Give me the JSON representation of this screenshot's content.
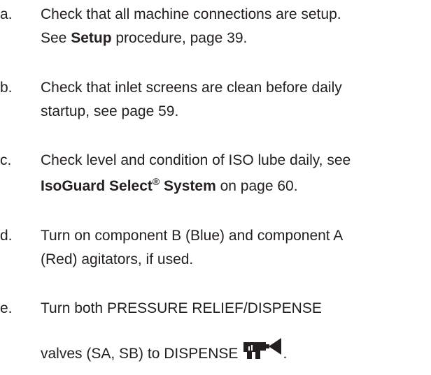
{
  "steps": [
    {
      "marker": "a.",
      "line1": "Check that all machine connections are setup.",
      "line2_prefix": "See ",
      "line2_bold": "Setup",
      "line2_suffix": " procedure, page 39."
    },
    {
      "marker": "b.",
      "line1": "Check that inlet screens are clean before daily",
      "line2": "startup, see page 59."
    },
    {
      "marker": "c.",
      "line1": "Check level and condition of ISO lube daily, see",
      "line2_bold": "IsoGuard Select",
      "line2_sup": "®",
      "line2_bold2": " System",
      "line2_suffix": " on page 60."
    },
    {
      "marker": "d.",
      "line1": "Turn on component B (Blue) and component A",
      "line2": "(Red) agitators, if used."
    },
    {
      "marker": "e.",
      "line1": "Turn both PRESSURE RELIEF/DISPENSE",
      "line2": "valves (SA, SB) to DISPENSE",
      "icon": "dispense-gun-icon",
      "line2_end": "."
    }
  ]
}
